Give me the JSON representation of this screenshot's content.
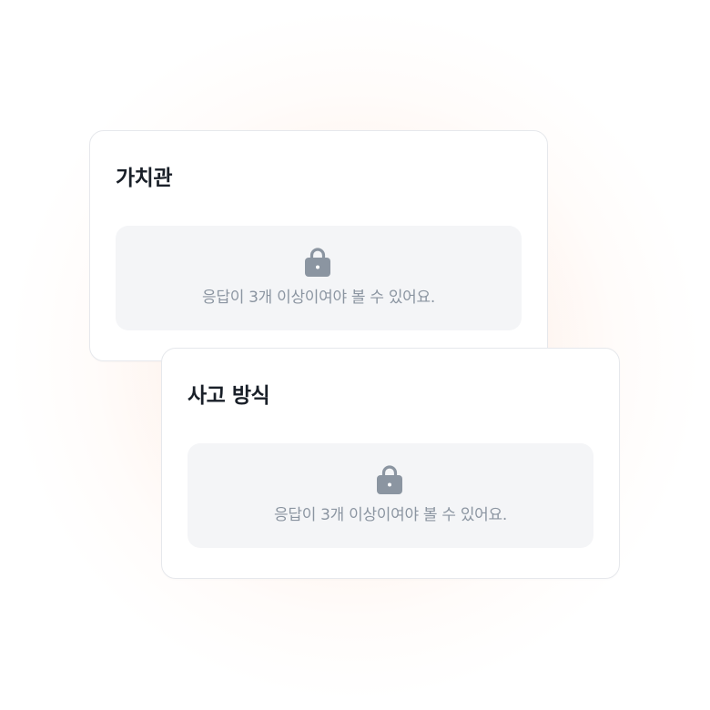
{
  "cards": [
    {
      "title": "가치관",
      "locked_message": "응답이 3개 이상이여야 볼 수 있어요.",
      "icon": "lock-icon"
    },
    {
      "title": "사고 방식",
      "locked_message": "응답이 3개 이상이여야 볼 수 있어요.",
      "icon": "lock-icon"
    }
  ],
  "colors": {
    "title": "#191f28",
    "muted_text": "#8b95a1",
    "icon": "#8b95a1",
    "locked_bg": "#f4f5f7",
    "card_border": "#e6e8ec",
    "glow": "#fdece2"
  }
}
